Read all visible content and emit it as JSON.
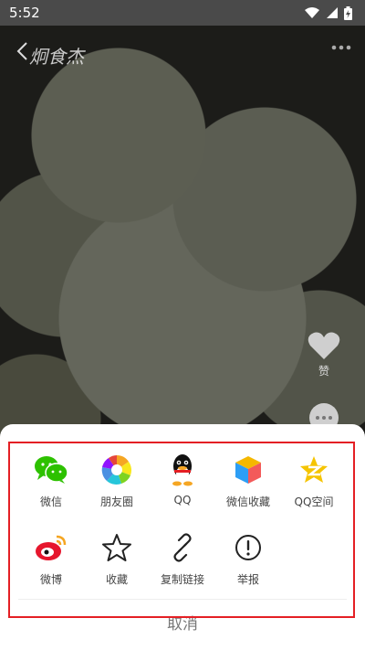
{
  "status_bar": {
    "time": "5:52"
  },
  "header": {
    "logo_text": "炯食杰"
  },
  "side_actions": {
    "like_label": "赞"
  },
  "share_sheet": {
    "row1": [
      {
        "label": "微信",
        "icon": "wechat-icon"
      },
      {
        "label": "朋友圈",
        "icon": "moments-icon"
      },
      {
        "label": "QQ",
        "icon": "qq-icon"
      },
      {
        "label": "微信收藏",
        "icon": "wechat-favorites-icon"
      },
      {
        "label": "QQ空间",
        "icon": "qzone-icon"
      }
    ],
    "row2": [
      {
        "label": "微博",
        "icon": "weibo-icon"
      },
      {
        "label": "收藏",
        "icon": "star-icon"
      },
      {
        "label": "复制链接",
        "icon": "link-icon"
      },
      {
        "label": "举报",
        "icon": "report-icon"
      }
    ],
    "cancel_label": "取消"
  },
  "colors": {
    "highlight_border": "#e41f24",
    "wechat_green": "#2dc100",
    "qzone_yellow": "#f5c400",
    "weibo_red": "#e6162d"
  }
}
